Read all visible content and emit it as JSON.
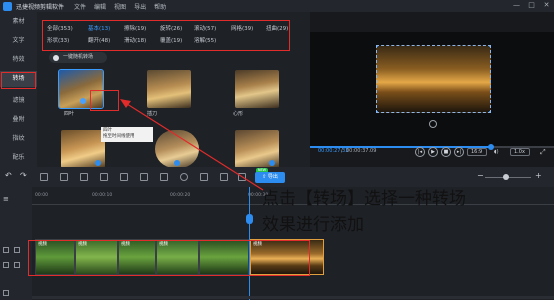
{
  "app": {
    "title": "迅捷视频剪辑软件",
    "menu": [
      "文件",
      "编辑",
      "视图",
      "导出",
      "帮助"
    ],
    "window_controls": [
      "—",
      "□",
      "✕"
    ]
  },
  "sidebar": {
    "items": [
      {
        "label": "素材",
        "icon": "media-icon"
      },
      {
        "label": "文字",
        "icon": "text-icon"
      },
      {
        "label": "特效",
        "icon": "effects-icon"
      },
      {
        "label": "转场",
        "icon": "transition-icon"
      },
      {
        "label": "滤镜",
        "icon": "filter-icon"
      },
      {
        "label": "叠附",
        "icon": "overlay-icon"
      },
      {
        "label": "指纹",
        "icon": "fingerprint-icon"
      },
      {
        "label": "配乐",
        "icon": "music-icon"
      }
    ],
    "active_index": 3
  },
  "library": {
    "tabs": [
      {
        "label": "全部(353)"
      },
      {
        "label": "基本(13)"
      },
      {
        "label": "擦除(19)"
      },
      {
        "label": "旋转(26)"
      },
      {
        "label": "滚动(57)"
      },
      {
        "label": "网格(39)"
      },
      {
        "label": "扭曲(29)"
      },
      {
        "label": "形状(33)"
      },
      {
        "label": "翻开(48)"
      },
      {
        "label": "滑动(18)"
      },
      {
        "label": "覆盖(19)"
      },
      {
        "label": "溶解(55)"
      }
    ],
    "active_tab": 1,
    "random_button": "一键随机转场",
    "thumbs": [
      {
        "label": "四叶"
      },
      {
        "label": "插刀"
      },
      {
        "label": "心形"
      },
      {
        "label": ""
      },
      {
        "label": ""
      },
      {
        "label": ""
      }
    ],
    "tooltip": {
      "title": "四叶",
      "text": "拖至时间线使用"
    }
  },
  "preview": {
    "current_time": "00:00:27.33",
    "total_time": "00:00:37.09",
    "aspect_ratio": "16:9",
    "speed": "1.0x",
    "progress": 0.74
  },
  "toolbar": {
    "export_label": "导出",
    "new_badge": "NEW"
  },
  "timeline": {
    "ticks": [
      "00:00",
      "00:00:10",
      "00:00:20",
      "00:00:30"
    ],
    "clips": [
      {
        "label": "视频"
      },
      {
        "label": "视频"
      },
      {
        "label": "视频"
      },
      {
        "label": "视频"
      },
      {
        "label": "视频"
      }
    ]
  },
  "annotation": {
    "line1": "点击【转场】选择一种转场",
    "line2": "效果进行添加"
  },
  "colors": {
    "accent": "#2d8cf0",
    "annotation": "#e22b2b"
  }
}
